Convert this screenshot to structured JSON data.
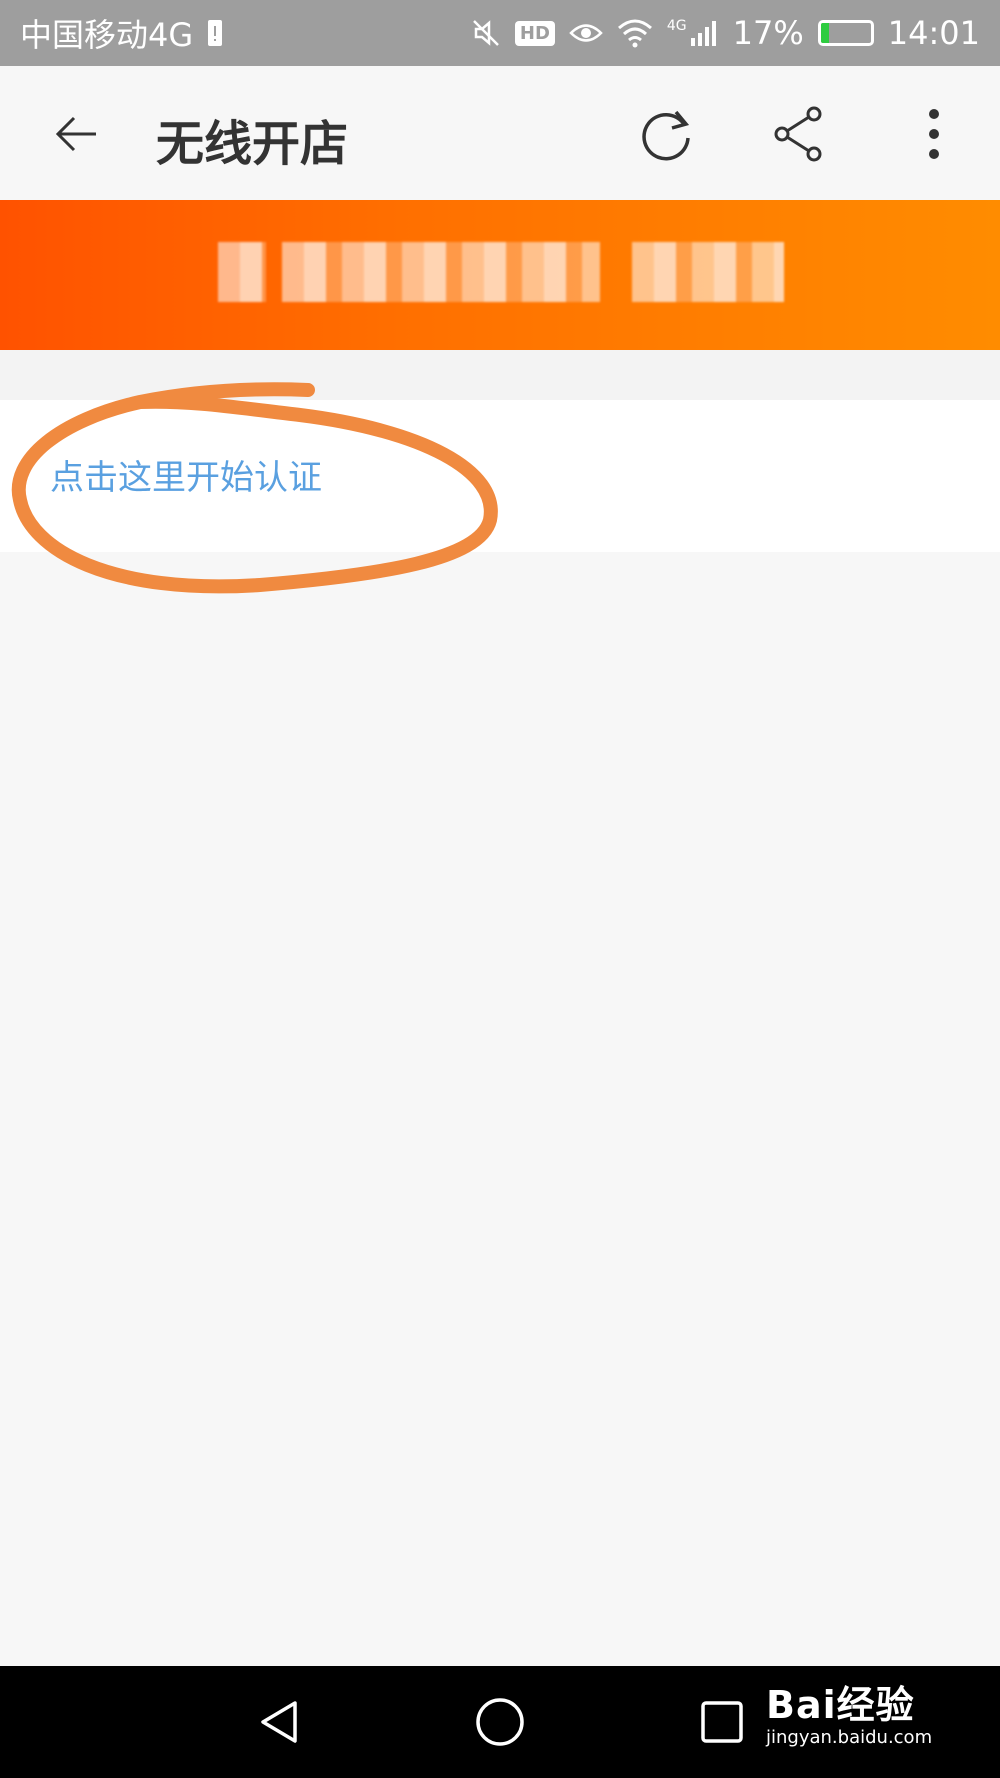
{
  "status_bar": {
    "carrier": "中国移动4G",
    "hd_label": "HD",
    "network_label": "4G",
    "battery_percent": "17%",
    "battery_level": 0.17,
    "time": "14:01",
    "colors": {
      "background": "#9e9e9e",
      "battery": "#2ecc40"
    }
  },
  "toolbar": {
    "title": "无线开店",
    "icons": [
      "back-arrow-icon",
      "refresh-icon",
      "share-icon",
      "more-icon"
    ]
  },
  "banner": {
    "colors": {
      "start": "#ff5200",
      "end": "#ff8c00"
    }
  },
  "content": {
    "cert_link": "点击这里开始认证",
    "colors": {
      "link": "#5aa0e0",
      "annotation": "#f08a40"
    }
  },
  "nav_bar": {
    "icons": [
      "triangle-back-icon",
      "circle-home-icon",
      "square-recent-icon"
    ]
  },
  "watermark": {
    "brand": "Bai经验",
    "url": "jingyan.baidu.com"
  }
}
